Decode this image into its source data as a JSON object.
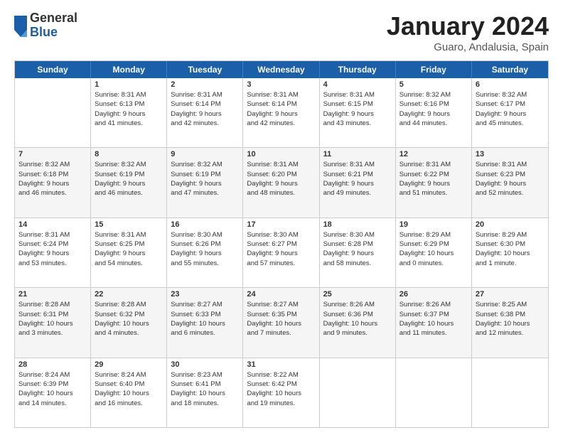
{
  "header": {
    "logo_general": "General",
    "logo_blue": "Blue",
    "title": "January 2024",
    "location": "Guaro, Andalusia, Spain"
  },
  "weekdays": [
    "Sunday",
    "Monday",
    "Tuesday",
    "Wednesday",
    "Thursday",
    "Friday",
    "Saturday"
  ],
  "rows": [
    {
      "alt": false,
      "cells": [
        {
          "day": "",
          "lines": []
        },
        {
          "day": "1",
          "lines": [
            "Sunrise: 8:31 AM",
            "Sunset: 6:13 PM",
            "Daylight: 9 hours",
            "and 41 minutes."
          ]
        },
        {
          "day": "2",
          "lines": [
            "Sunrise: 8:31 AM",
            "Sunset: 6:14 PM",
            "Daylight: 9 hours",
            "and 42 minutes."
          ]
        },
        {
          "day": "3",
          "lines": [
            "Sunrise: 8:31 AM",
            "Sunset: 6:14 PM",
            "Daylight: 9 hours",
            "and 42 minutes."
          ]
        },
        {
          "day": "4",
          "lines": [
            "Sunrise: 8:31 AM",
            "Sunset: 6:15 PM",
            "Daylight: 9 hours",
            "and 43 minutes."
          ]
        },
        {
          "day": "5",
          "lines": [
            "Sunrise: 8:32 AM",
            "Sunset: 6:16 PM",
            "Daylight: 9 hours",
            "and 44 minutes."
          ]
        },
        {
          "day": "6",
          "lines": [
            "Sunrise: 8:32 AM",
            "Sunset: 6:17 PM",
            "Daylight: 9 hours",
            "and 45 minutes."
          ]
        }
      ]
    },
    {
      "alt": true,
      "cells": [
        {
          "day": "7",
          "lines": [
            "Sunrise: 8:32 AM",
            "Sunset: 6:18 PM",
            "Daylight: 9 hours",
            "and 46 minutes."
          ]
        },
        {
          "day": "8",
          "lines": [
            "Sunrise: 8:32 AM",
            "Sunset: 6:19 PM",
            "Daylight: 9 hours",
            "and 46 minutes."
          ]
        },
        {
          "day": "9",
          "lines": [
            "Sunrise: 8:32 AM",
            "Sunset: 6:19 PM",
            "Daylight: 9 hours",
            "and 47 minutes."
          ]
        },
        {
          "day": "10",
          "lines": [
            "Sunrise: 8:31 AM",
            "Sunset: 6:20 PM",
            "Daylight: 9 hours",
            "and 48 minutes."
          ]
        },
        {
          "day": "11",
          "lines": [
            "Sunrise: 8:31 AM",
            "Sunset: 6:21 PM",
            "Daylight: 9 hours",
            "and 49 minutes."
          ]
        },
        {
          "day": "12",
          "lines": [
            "Sunrise: 8:31 AM",
            "Sunset: 6:22 PM",
            "Daylight: 9 hours",
            "and 51 minutes."
          ]
        },
        {
          "day": "13",
          "lines": [
            "Sunrise: 8:31 AM",
            "Sunset: 6:23 PM",
            "Daylight: 9 hours",
            "and 52 minutes."
          ]
        }
      ]
    },
    {
      "alt": false,
      "cells": [
        {
          "day": "14",
          "lines": [
            "Sunrise: 8:31 AM",
            "Sunset: 6:24 PM",
            "Daylight: 9 hours",
            "and 53 minutes."
          ]
        },
        {
          "day": "15",
          "lines": [
            "Sunrise: 8:31 AM",
            "Sunset: 6:25 PM",
            "Daylight: 9 hours",
            "and 54 minutes."
          ]
        },
        {
          "day": "16",
          "lines": [
            "Sunrise: 8:30 AM",
            "Sunset: 6:26 PM",
            "Daylight: 9 hours",
            "and 55 minutes."
          ]
        },
        {
          "day": "17",
          "lines": [
            "Sunrise: 8:30 AM",
            "Sunset: 6:27 PM",
            "Daylight: 9 hours",
            "and 57 minutes."
          ]
        },
        {
          "day": "18",
          "lines": [
            "Sunrise: 8:30 AM",
            "Sunset: 6:28 PM",
            "Daylight: 9 hours",
            "and 58 minutes."
          ]
        },
        {
          "day": "19",
          "lines": [
            "Sunrise: 8:29 AM",
            "Sunset: 6:29 PM",
            "Daylight: 10 hours",
            "and 0 minutes."
          ]
        },
        {
          "day": "20",
          "lines": [
            "Sunrise: 8:29 AM",
            "Sunset: 6:30 PM",
            "Daylight: 10 hours",
            "and 1 minute."
          ]
        }
      ]
    },
    {
      "alt": true,
      "cells": [
        {
          "day": "21",
          "lines": [
            "Sunrise: 8:28 AM",
            "Sunset: 6:31 PM",
            "Daylight: 10 hours",
            "and 3 minutes."
          ]
        },
        {
          "day": "22",
          "lines": [
            "Sunrise: 8:28 AM",
            "Sunset: 6:32 PM",
            "Daylight: 10 hours",
            "and 4 minutes."
          ]
        },
        {
          "day": "23",
          "lines": [
            "Sunrise: 8:27 AM",
            "Sunset: 6:33 PM",
            "Daylight: 10 hours",
            "and 6 minutes."
          ]
        },
        {
          "day": "24",
          "lines": [
            "Sunrise: 8:27 AM",
            "Sunset: 6:35 PM",
            "Daylight: 10 hours",
            "and 7 minutes."
          ]
        },
        {
          "day": "25",
          "lines": [
            "Sunrise: 8:26 AM",
            "Sunset: 6:36 PM",
            "Daylight: 10 hours",
            "and 9 minutes."
          ]
        },
        {
          "day": "26",
          "lines": [
            "Sunrise: 8:26 AM",
            "Sunset: 6:37 PM",
            "Daylight: 10 hours",
            "and 11 minutes."
          ]
        },
        {
          "day": "27",
          "lines": [
            "Sunrise: 8:25 AM",
            "Sunset: 6:38 PM",
            "Daylight: 10 hours",
            "and 12 minutes."
          ]
        }
      ]
    },
    {
      "alt": false,
      "cells": [
        {
          "day": "28",
          "lines": [
            "Sunrise: 8:24 AM",
            "Sunset: 6:39 PM",
            "Daylight: 10 hours",
            "and 14 minutes."
          ]
        },
        {
          "day": "29",
          "lines": [
            "Sunrise: 8:24 AM",
            "Sunset: 6:40 PM",
            "Daylight: 10 hours",
            "and 16 minutes."
          ]
        },
        {
          "day": "30",
          "lines": [
            "Sunrise: 8:23 AM",
            "Sunset: 6:41 PM",
            "Daylight: 10 hours",
            "and 18 minutes."
          ]
        },
        {
          "day": "31",
          "lines": [
            "Sunrise: 8:22 AM",
            "Sunset: 6:42 PM",
            "Daylight: 10 hours",
            "and 19 minutes."
          ]
        },
        {
          "day": "",
          "lines": []
        },
        {
          "day": "",
          "lines": []
        },
        {
          "day": "",
          "lines": []
        }
      ]
    }
  ]
}
